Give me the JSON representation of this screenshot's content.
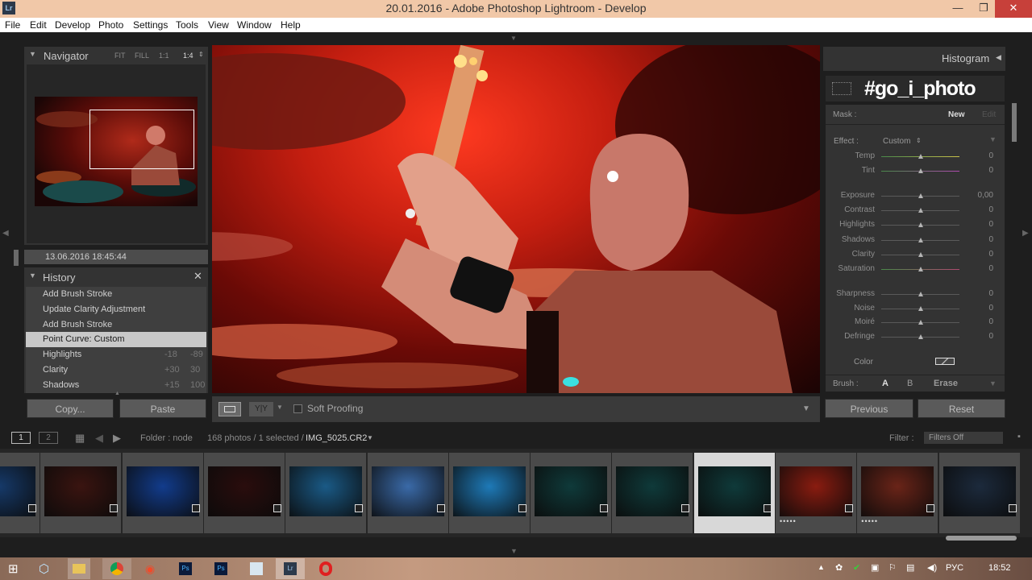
{
  "window": {
    "title": "20.01.2016 - Adobe Photoshop Lightroom - Develop",
    "app_icon": "Lr",
    "controls": [
      "—",
      "❐",
      "✕"
    ]
  },
  "menu": [
    "File",
    "Edit",
    "Develop",
    "Photo",
    "Settings",
    "Tools",
    "View",
    "Window",
    "Help"
  ],
  "navigator": {
    "title": "Navigator",
    "zoom_options": [
      "FIT",
      "FILL",
      "1:1",
      "1:4"
    ],
    "selected_zoom": "1:4",
    "date": "13.06.2016 18:45:44"
  },
  "history": {
    "title": "History",
    "items": [
      {
        "label": "Add Brush Stroke",
        "v1": "",
        "v2": ""
      },
      {
        "label": "Update Clarity Adjustment",
        "v1": "",
        "v2": ""
      },
      {
        "label": "Add Brush Stroke",
        "v1": "",
        "v2": ""
      },
      {
        "label": "Point Curve: Custom",
        "v1": "",
        "v2": ""
      },
      {
        "label": "Highlights",
        "v1": "-18",
        "v2": "-89"
      },
      {
        "label": "Clarity",
        "v1": "+30",
        "v2": "30"
      },
      {
        "label": "Shadows",
        "v1": "+15",
        "v2": "100"
      }
    ],
    "selected_index": 3
  },
  "left_buttons": {
    "copy": "Copy...",
    "paste": "Paste"
  },
  "toolbar": {
    "soft_proofing": "Soft Proofing",
    "compare_label": "Y|Y"
  },
  "right_panel": {
    "histogram_title": "Histogram",
    "watermark": "#go_i_photo",
    "mask_label": "Mask :",
    "mask_new": "New",
    "mask_edit": "Edit",
    "effect_label": "Effect :",
    "effect_value": "Custom",
    "sliders": [
      {
        "label": "Temp",
        "value": "0",
        "color": "#c9c24a"
      },
      {
        "label": "Tint",
        "value": "0",
        "color": "#b04ab0"
      },
      {
        "label": "Exposure",
        "value": "0,00",
        "color": ""
      },
      {
        "label": "Contrast",
        "value": "0",
        "color": ""
      },
      {
        "label": "Highlights",
        "value": "0",
        "color": ""
      },
      {
        "label": "Shadows",
        "value": "0",
        "color": ""
      },
      {
        "label": "Clarity",
        "value": "0",
        "color": ""
      },
      {
        "label": "Saturation",
        "value": "0",
        "color": "#b04a70"
      },
      {
        "label": "Sharpness",
        "value": "0",
        "color": ""
      },
      {
        "label": "Noise",
        "value": "0",
        "color": ""
      },
      {
        "label": "Moiré",
        "value": "0",
        "color": ""
      },
      {
        "label": "Defringe",
        "value": "0",
        "color": ""
      }
    ],
    "color_label": "Color",
    "brush_label": "Brush :",
    "brush_a": "A",
    "brush_b": "B",
    "brush_erase": "Erase",
    "previous": "Previous",
    "reset": "Reset"
  },
  "filmstrip_bar": {
    "screen1": "1",
    "screen2": "2",
    "folder": "Folder : node",
    "count": "168 photos / 1 selected /",
    "filename": "IMG_5025.CR2",
    "filter_label": "Filter :",
    "filter_value": "Filters Off"
  },
  "filmstrip": [
    {
      "tone": "#163a6a",
      "stars": ""
    },
    {
      "tone": "#3a1410",
      "stars": ""
    },
    {
      "tone": "#123c8c",
      "stars": ""
    },
    {
      "tone": "#2a0d0d",
      "stars": ""
    },
    {
      "tone": "#1a5a86",
      "stars": ""
    },
    {
      "tone": "#3a6aa8",
      "stars": ""
    },
    {
      "tone": "#1e7ab8",
      "stars": ""
    },
    {
      "tone": "#0f3a3a",
      "stars": ""
    },
    {
      "tone": "#0f3a3a",
      "stars": ""
    },
    {
      "tone": "#0f3a3a",
      "stars": ""
    },
    {
      "tone": "#8a1c10",
      "stars": "•••••"
    },
    {
      "tone": "#6a2418",
      "stars": "•••••"
    },
    {
      "tone": "#1c2a3c",
      "stars": ""
    }
  ],
  "selected_thumb": 9,
  "taskbar": {
    "lang": "РУС",
    "time": "18:52"
  }
}
